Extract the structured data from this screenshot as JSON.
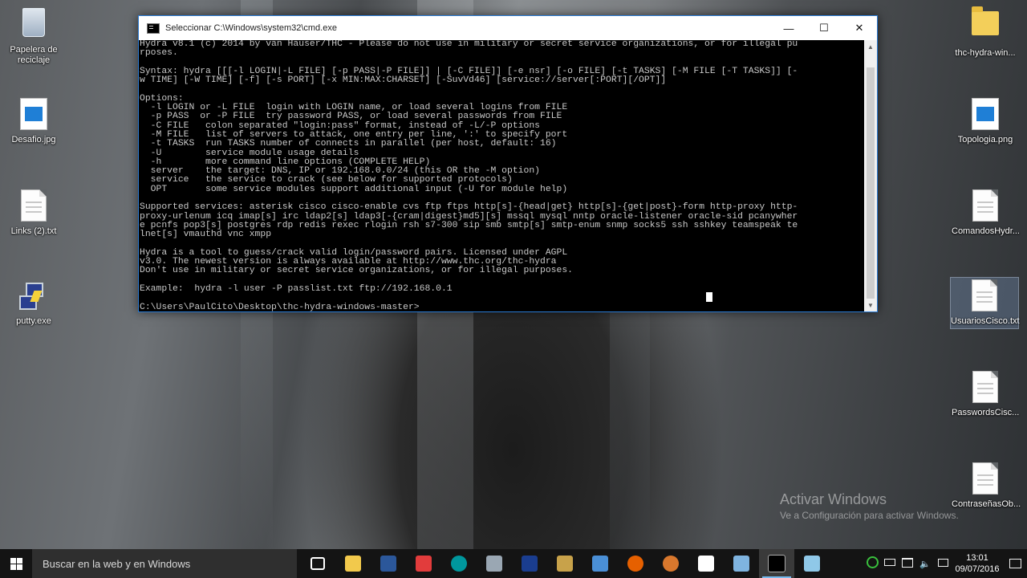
{
  "desktop": {
    "left_icons": [
      {
        "label": "Papelera de reciclaje",
        "icon": "recycle-bin-icon"
      },
      {
        "label": "Desafio.jpg",
        "icon": "image-file-icon"
      },
      {
        "label": "Links (2).txt",
        "icon": "text-file-icon"
      },
      {
        "label": "putty.exe",
        "icon": "putty-icon"
      }
    ],
    "right_icons": [
      {
        "label": "thc-hydra-win...",
        "icon": "folder-icon"
      },
      {
        "label": "Topologia.png",
        "icon": "image-file-icon"
      },
      {
        "label": "ComandosHydr...",
        "icon": "text-file-icon"
      },
      {
        "label": "UsuariosCisco.txt",
        "icon": "text-file-icon"
      },
      {
        "label": "PasswordsCisc...",
        "icon": "text-file-icon"
      },
      {
        "label": "ContraseñasOb...",
        "icon": "text-file-icon"
      }
    ]
  },
  "cmd": {
    "title": "Seleccionar C:\\Windows\\system32\\cmd.exe",
    "lines": [
      "Hydra v8.1 (c) 2014 by van Hauser/THC - Please do not use in military or secret service organizations, or for illegal pu",
      "rposes.",
      "",
      "Syntax: hydra [[[-l LOGIN|-L FILE] [-p PASS|-P FILE]] | [-C FILE]] [-e nsr] [-o FILE] [-t TASKS] [-M FILE [-T TASKS]] [-",
      "w TIME] [-W TIME] [-f] [-s PORT] [-x MIN:MAX:CHARSET] [-SuvVd46] [service://server[:PORT][/OPT]]",
      "",
      "Options:",
      "  -l LOGIN or -L FILE  login with LOGIN name, or load several logins from FILE",
      "  -p PASS  or -P FILE  try password PASS, or load several passwords from FILE",
      "  -C FILE   colon separated \"login:pass\" format, instead of -L/-P options",
      "  -M FILE   list of servers to attack, one entry per line, ':' to specify port",
      "  -t TASKS  run TASKS number of connects in parallel (per host, default: 16)",
      "  -U        service module usage details",
      "  -h        more command line options (COMPLETE HELP)",
      "  server    the target: DNS, IP or 192.168.0.0/24 (this OR the -M option)",
      "  service   the service to crack (see below for supported protocols)",
      "  OPT       some service modules support additional input (-U for module help)",
      "",
      "Supported services: asterisk cisco cisco-enable cvs ftp ftps http[s]-{head|get} http[s]-{get|post}-form http-proxy http-",
      "proxy-urlenum icq imap[s] irc ldap2[s] ldap3[-{cram|digest}md5][s] mssql mysql nntp oracle-listener oracle-sid pcanywher",
      "e pcnfs pop3[s] postgres rdp redis rexec rlogin rsh s7-300 sip smb smtp[s] smtp-enum snmp socks5 ssh sshkey teamspeak te",
      "lnet[s] vmauthd vnc xmpp",
      "",
      "Hydra is a tool to guess/crack valid login/password pairs. Licensed under AGPL",
      "v3.0. The newest version is always available at http://www.thc.org/thc-hydra",
      "Don't use in military or secret service organizations, or for illegal purposes.",
      "",
      "Example:  hydra -l user -P passlist.txt ftp://192.168.0.1",
      "",
      "C:\\Users\\PaulCito\\Desktop\\thc-hydra-windows-master>"
    ],
    "minimize": "—",
    "maximize": "☐",
    "close": "✕"
  },
  "watermark": {
    "line1": "Activar Windows",
    "line2": "Ve a Configuración para activar Windows."
  },
  "taskbar": {
    "search_placeholder": "Buscar en la web y en Windows",
    "apps": [
      {
        "name": "task-view-icon",
        "color": "#ffffff"
      },
      {
        "name": "file-explorer-icon",
        "color": "#f2c94c"
      },
      {
        "name": "word-icon",
        "color": "#2b579a"
      },
      {
        "name": "app-ic-icon",
        "color": "#e23c3c"
      },
      {
        "name": "arduino-icon",
        "color": "#00979d"
      },
      {
        "name": "tool-icon",
        "color": "#9aa7b3"
      },
      {
        "name": "league-icon",
        "color": "#1a3d8f"
      },
      {
        "name": "game-icon",
        "color": "#c8a24a"
      },
      {
        "name": "network-tool-icon",
        "color": "#4a8fd6"
      },
      {
        "name": "firefox-icon",
        "color": "#e66000"
      },
      {
        "name": "gimp-icon",
        "color": "#d9782d"
      },
      {
        "name": "photos-icon",
        "color": "#ffffff"
      },
      {
        "name": "eye-app-icon",
        "color": "#7fb4e0"
      },
      {
        "name": "cmd-icon",
        "color": "#000000"
      },
      {
        "name": "notepad-icon",
        "color": "#8fc8e8"
      }
    ],
    "clock_time": "13:01",
    "clock_date": "09/07/2016"
  }
}
